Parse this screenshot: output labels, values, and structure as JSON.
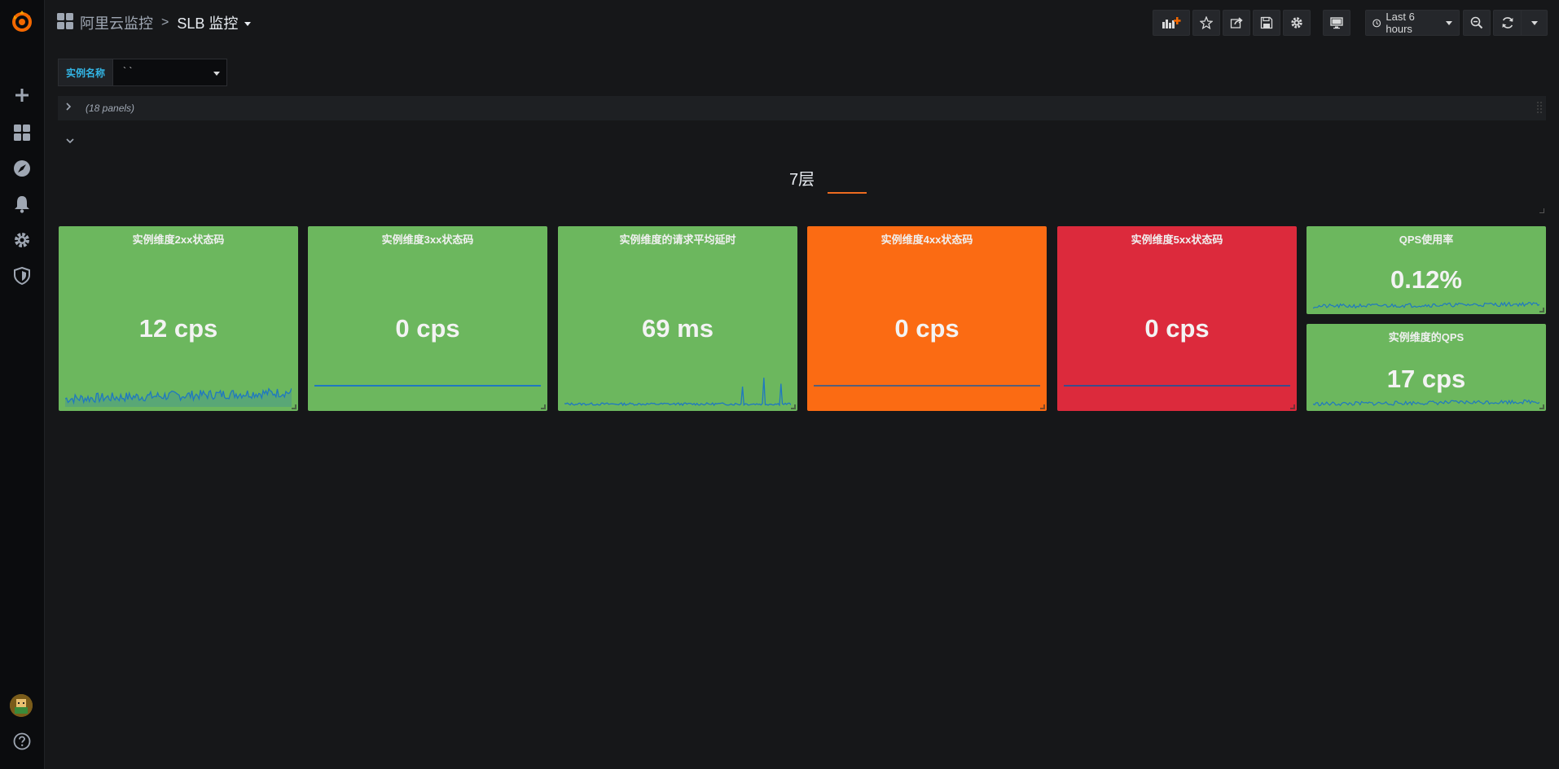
{
  "navbar": {
    "folder": "阿里云监控",
    "separator": ">",
    "title": "SLB 监控",
    "time_range": "Last 6 hours"
  },
  "icons": {
    "logo": "grafana-logo-icon",
    "create": "plus-icon",
    "dashboards": "grid-icon",
    "explore": "compass-icon",
    "alerting": "bell-icon",
    "configuration": "gear-icon",
    "server_admin": "shield-icon",
    "help": "question-circle-icon"
  },
  "variables": {
    "instance_label": "实例名称",
    "instance_value": "` `"
  },
  "collapsed_row": {
    "panel_count": "(18 panels)"
  },
  "text_panel": {
    "title": "7层"
  },
  "panels": [
    {
      "title": "实例维度2xx状态码",
      "value": "12 cps",
      "color": "#6cb75e"
    },
    {
      "title": "实例维度3xx状态码",
      "value": "0 cps",
      "color": "#6cb75e"
    },
    {
      "title": "实例维度的请求平均延时",
      "value": "69 ms",
      "color": "#6cb75e"
    },
    {
      "title": "实例维度4xx状态码",
      "value": "0 cps",
      "color": "#fb6b13"
    },
    {
      "title": "实例维度5xx状态码",
      "value": "0 cps",
      "color": "#dc2a3c"
    },
    {
      "title": "QPS使用率",
      "value": "0.12%",
      "color": "#6cb75e"
    },
    {
      "title": "实例维度的QPS",
      "value": "17 cps",
      "color": "#6cb75e"
    }
  ],
  "colors": {
    "background": "#161719",
    "sidebar": "#0b0c0e",
    "accent_orange": "#ed6b20",
    "variable_label": "#33b5e5",
    "sparkline": "#1f78c1"
  }
}
